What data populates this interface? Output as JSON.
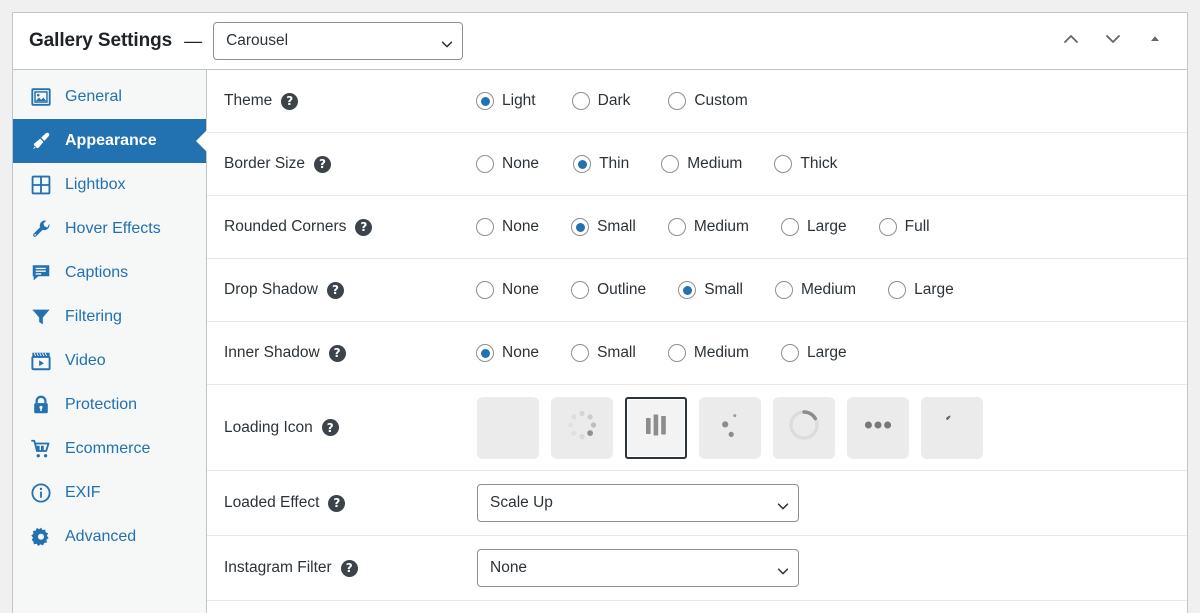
{
  "header": {
    "title": "Gallery Settings",
    "separator": "—",
    "gallery_type": "Carousel",
    "actions": [
      {
        "name": "move-up",
        "icon": "chevron-up-icon"
      },
      {
        "name": "move-down",
        "icon": "chevron-down-icon"
      },
      {
        "name": "collapse",
        "icon": "triangle-up-icon"
      }
    ]
  },
  "accent_color": "#2271b1",
  "sidebar": {
    "items": [
      {
        "label": "General",
        "icon": "image-icon",
        "active": false
      },
      {
        "label": "Appearance",
        "icon": "brush-icon",
        "active": true
      },
      {
        "label": "Lightbox",
        "icon": "grid-icon",
        "active": false
      },
      {
        "label": "Hover Effects",
        "icon": "wrench-icon",
        "active": false
      },
      {
        "label": "Captions",
        "icon": "comment-icon",
        "active": false
      },
      {
        "label": "Filtering",
        "icon": "funnel-icon",
        "active": false
      },
      {
        "label": "Video",
        "icon": "video-icon",
        "active": false
      },
      {
        "label": "Protection",
        "icon": "lock-icon",
        "active": false
      },
      {
        "label": "Ecommerce",
        "icon": "cart-icon",
        "active": false
      },
      {
        "label": "EXIF",
        "icon": "info-icon",
        "active": false
      },
      {
        "label": "Advanced",
        "icon": "gear-icon",
        "active": false
      }
    ]
  },
  "rows": [
    {
      "label": "Theme",
      "help": "?",
      "type": "radio",
      "options": [
        {
          "label": "Light",
          "checked": true
        },
        {
          "label": "Dark",
          "checked": false
        },
        {
          "label": "Custom",
          "checked": false
        }
      ],
      "gaps": [
        0,
        36,
        38
      ]
    },
    {
      "label": "Border Size",
      "help": "?",
      "type": "radio",
      "options": [
        {
          "label": "None",
          "checked": false
        },
        {
          "label": "Thin",
          "checked": true
        },
        {
          "label": "Medium",
          "checked": false
        },
        {
          "label": "Thick",
          "checked": false
        }
      ],
      "gaps": [
        0,
        34,
        32,
        32
      ]
    },
    {
      "label": "Rounded Corners",
      "help": "?",
      "type": "radio",
      "options": [
        {
          "label": "None",
          "checked": false
        },
        {
          "label": "Small",
          "checked": true
        },
        {
          "label": "Medium",
          "checked": false
        },
        {
          "label": "Large",
          "checked": false
        },
        {
          "label": "Full",
          "checked": false
        }
      ],
      "gaps": [
        0,
        32,
        32,
        32,
        32
      ]
    },
    {
      "label": "Drop Shadow",
      "help": "?",
      "type": "radio",
      "options": [
        {
          "label": "None",
          "checked": false
        },
        {
          "label": "Outline",
          "checked": false
        },
        {
          "label": "Small",
          "checked": true
        },
        {
          "label": "Medium",
          "checked": false
        },
        {
          "label": "Large",
          "checked": false
        }
      ],
      "gaps": [
        0,
        32,
        32,
        32,
        32
      ]
    },
    {
      "label": "Inner Shadow",
      "help": "?",
      "type": "radio",
      "options": [
        {
          "label": "None",
          "checked": true
        },
        {
          "label": "Small",
          "checked": false
        },
        {
          "label": "Medium",
          "checked": false
        },
        {
          "label": "Large",
          "checked": false
        }
      ],
      "gaps": [
        0,
        32,
        32,
        32
      ]
    },
    {
      "label": "Loading Icon",
      "help": "?",
      "type": "swatches",
      "options": [
        {
          "icon": "none-blank-icon",
          "selected": false
        },
        {
          "icon": "dot-ring-spinner-icon",
          "selected": false
        },
        {
          "icon": "bars-spinner-icon",
          "selected": true
        },
        {
          "icon": "dots-diagonal-icon",
          "selected": false
        },
        {
          "icon": "ring-spinner-icon",
          "selected": false
        },
        {
          "icon": "three-dots-icon",
          "selected": false
        },
        {
          "icon": "comet-spinner-icon",
          "selected": false
        }
      ]
    },
    {
      "label": "Loaded Effect",
      "help": "?",
      "type": "select",
      "value": "Scale Up"
    },
    {
      "label": "Instagram Filter",
      "help": "?",
      "type": "select",
      "value": "None"
    }
  ]
}
